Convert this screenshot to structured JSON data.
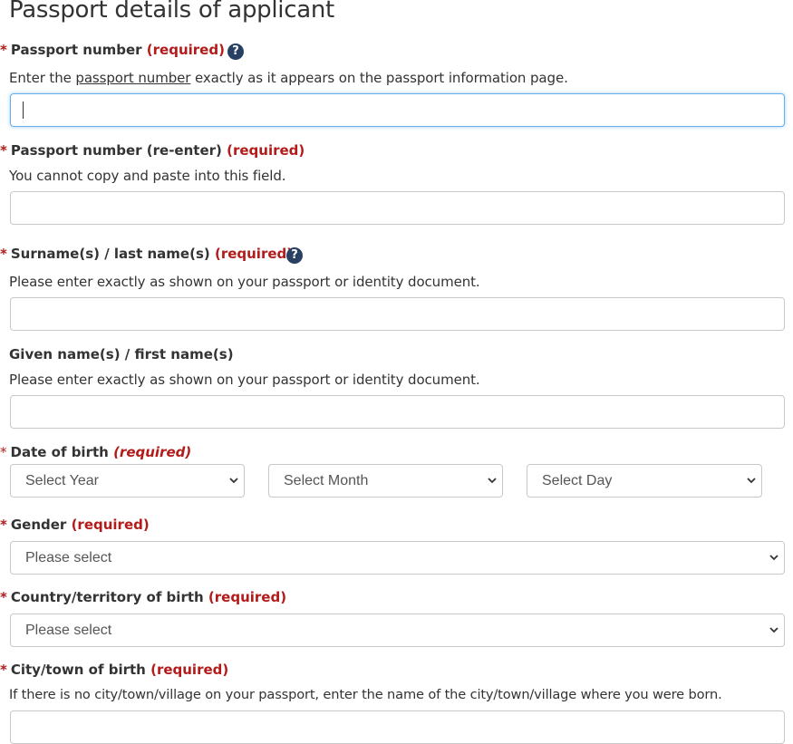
{
  "page_title": "Passport details of applicant",
  "required_marker": "*",
  "required_text": "(required)",
  "help_icon_glyph": "?",
  "fields": {
    "passport_number": {
      "label": "Passport number",
      "help_prefix": "Enter the",
      "help_link": "passport number",
      "help_suffix": "exactly as it appears on the passport information page.",
      "value": ""
    },
    "passport_number_reenter": {
      "label": "Passport number (re-enter)",
      "help": "You cannot copy and paste into this field.",
      "value": ""
    },
    "surname": {
      "label": "Surname(s) / last name(s)",
      "help": "Please enter exactly as shown on your passport or identity document.",
      "value": ""
    },
    "given_names": {
      "label": "Given name(s) / first name(s)",
      "help": "Please enter exactly as shown on your passport or identity document.",
      "value": ""
    },
    "date_of_birth": {
      "label": "Date of birth",
      "year_selected": "Select Year",
      "month_selected": "Select Month",
      "day_selected": "Select Day"
    },
    "gender": {
      "label": "Gender",
      "selected": "Please select"
    },
    "country_of_birth": {
      "label": "Country/territory of birth",
      "selected": "Please select"
    },
    "city_of_birth": {
      "label": "City/town of birth",
      "help": "If there is no city/town/village on your passport, enter the name of the city/town/village where you were born.",
      "value": ""
    }
  },
  "colors": {
    "required_red": "#b31b1b",
    "help_icon_bg": "#284162",
    "focus_border": "#66afe9",
    "input_border": "#c8c8c8"
  },
  "icons": {
    "help": "question-circle-icon",
    "select_arrow": "chevron-down-icon"
  }
}
